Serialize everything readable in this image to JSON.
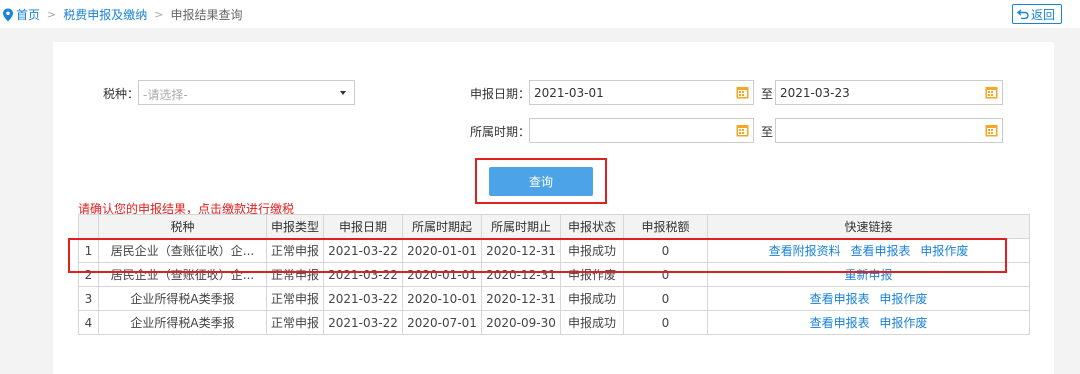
{
  "breadcrumb": {
    "home": "首页",
    "section": "税费申报及缴纳",
    "current": "申报结果查询",
    "separator": ">"
  },
  "back_label": "返回",
  "form": {
    "tax_type_label": "税种：",
    "tax_type_placeholder": "-请选择-",
    "declare_date_label": "申报日期：",
    "declare_date_from": "2021-03-01",
    "declare_date_to": "2021-03-23",
    "period_label": "所属时期：",
    "period_from": "",
    "period_to": "",
    "range_sep": "至",
    "query_label": "查询"
  },
  "notice": "请确认您的申报结果，点击缴款进行缴税",
  "table": {
    "headers": [
      "",
      "税种",
      "申报类型",
      "申报日期",
      "所属时期起",
      "所属时期止",
      "申报状态",
      "申报税额",
      "快速链接"
    ],
    "rows": [
      {
        "no": "1",
        "tax": "居民企业（查账征收）企...",
        "type": "正常申报",
        "date": "2021-03-22",
        "start": "2020-01-01",
        "end": "2020-12-31",
        "status": "申报成功",
        "amount": "0",
        "links": [
          "查看附报资料",
          "查看申报表",
          "申报作废"
        ]
      },
      {
        "no": "2",
        "tax": "居民企业（查账征收）企...",
        "type": "正常申报",
        "date": "2021-03-22",
        "start": "2020-01-01",
        "end": "2020-12-31",
        "status": "申报作废",
        "amount": "0",
        "links": [
          "重新申报"
        ]
      },
      {
        "no": "3",
        "tax": "企业所得税A类季报",
        "type": "正常申报",
        "date": "2021-03-22",
        "start": "2020-10-01",
        "end": "2020-12-31",
        "status": "申报成功",
        "amount": "0",
        "links": [
          "查看申报表",
          "申报作废"
        ]
      },
      {
        "no": "4",
        "tax": "企业所得税A类季报",
        "type": "正常申报",
        "date": "2021-03-22",
        "start": "2020-07-01",
        "end": "2020-09-30",
        "status": "申报成功",
        "amount": "0",
        "links": [
          "查看申报表",
          "申报作废"
        ]
      }
    ]
  },
  "colors": {
    "accent": "#1a82d9",
    "button": "#4da3e8",
    "highlight": "#e02020",
    "calendar_icon": "#f5a623"
  }
}
